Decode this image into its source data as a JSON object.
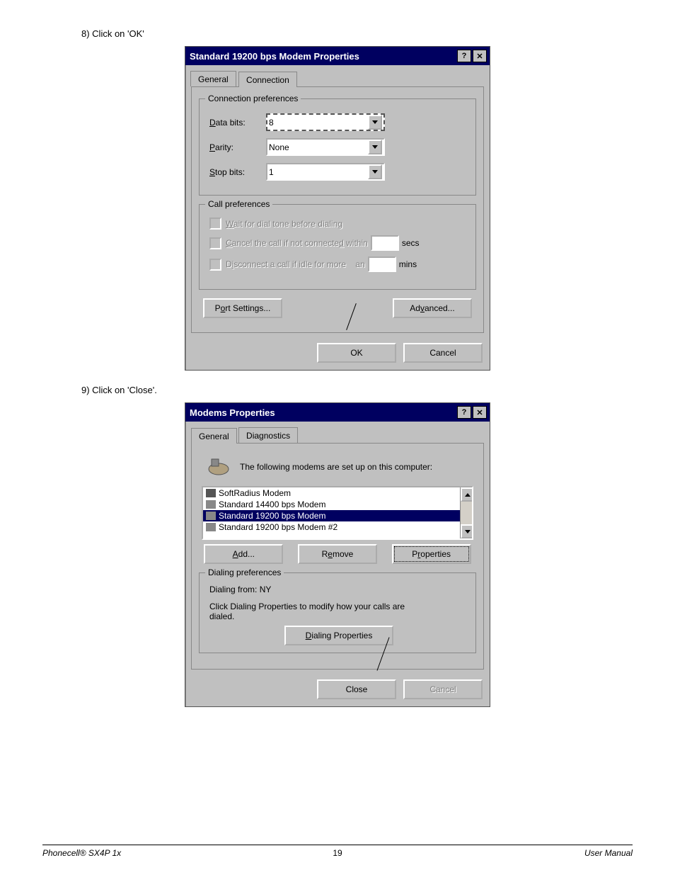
{
  "steps": {
    "step8": "8)  Click on 'OK'",
    "step9": "9)  Click on 'Close'."
  },
  "dialog1": {
    "title": "Standard 19200 bps Modem Properties",
    "help_btn": "?",
    "close_btn": "✕",
    "tabs": {
      "general": "General",
      "connection": "Connection"
    },
    "conn_prefs": {
      "legend": "Connection preferences",
      "data_bits_label": "Data bits:",
      "data_bits_underline": "D",
      "data_bits_value": "8",
      "parity_label": "Parity:",
      "parity_underline": "P",
      "parity_value": "None",
      "stop_bits_label": "Stop bits:",
      "stop_bits_underline": "S",
      "stop_bits_value": "1"
    },
    "call_prefs": {
      "legend": "Call preferences",
      "wait_label": "Wait for dial tone before dialing",
      "wait_underline": "W",
      "cancel_label": "Cancel the call if not connected within",
      "cancel_underline": "C",
      "cancel_unit": "secs",
      "idle_label": "Disconnect a call if idle for more     an",
      "idle_underline": "i",
      "idle_unit": "mins"
    },
    "port_settings": "Port Settings...",
    "port_settings_underline": "o",
    "advanced": "Advanced...",
    "advanced_underline": "v",
    "ok": "OK",
    "cancel": "Cancel"
  },
  "dialog2": {
    "title": "Modems Properties",
    "help_btn": "?",
    "close_btn": "✕",
    "tabs": {
      "general": "General",
      "diagnostics": "Diagnostics"
    },
    "intro": "The following modems are set up on this computer:",
    "modems": [
      {
        "name": "SoftRadius Modem",
        "selected": false
      },
      {
        "name": "Standard 14400 bps Modem",
        "selected": false
      },
      {
        "name": "Standard 19200 bps Modem",
        "selected": true
      },
      {
        "name": "Standard 19200 bps Modem #2",
        "selected": false
      }
    ],
    "add": "Add...",
    "add_underline": "A",
    "remove": "Remove",
    "remove_underline": "e",
    "properties": "Properties",
    "properties_underline": "r",
    "dialing_prefs": {
      "legend": "Dialing preferences",
      "from_label": "Dialing from:   NY",
      "hint": "Click Dialing Properties to modify how your calls are dialed.",
      "button": "Dialing Properties",
      "button_underline": "D"
    },
    "close": "Close",
    "cancel": "Cancel"
  },
  "footer": {
    "left": "Phonecell® SX4P 1x",
    "center": "19",
    "right": "User Manual"
  }
}
